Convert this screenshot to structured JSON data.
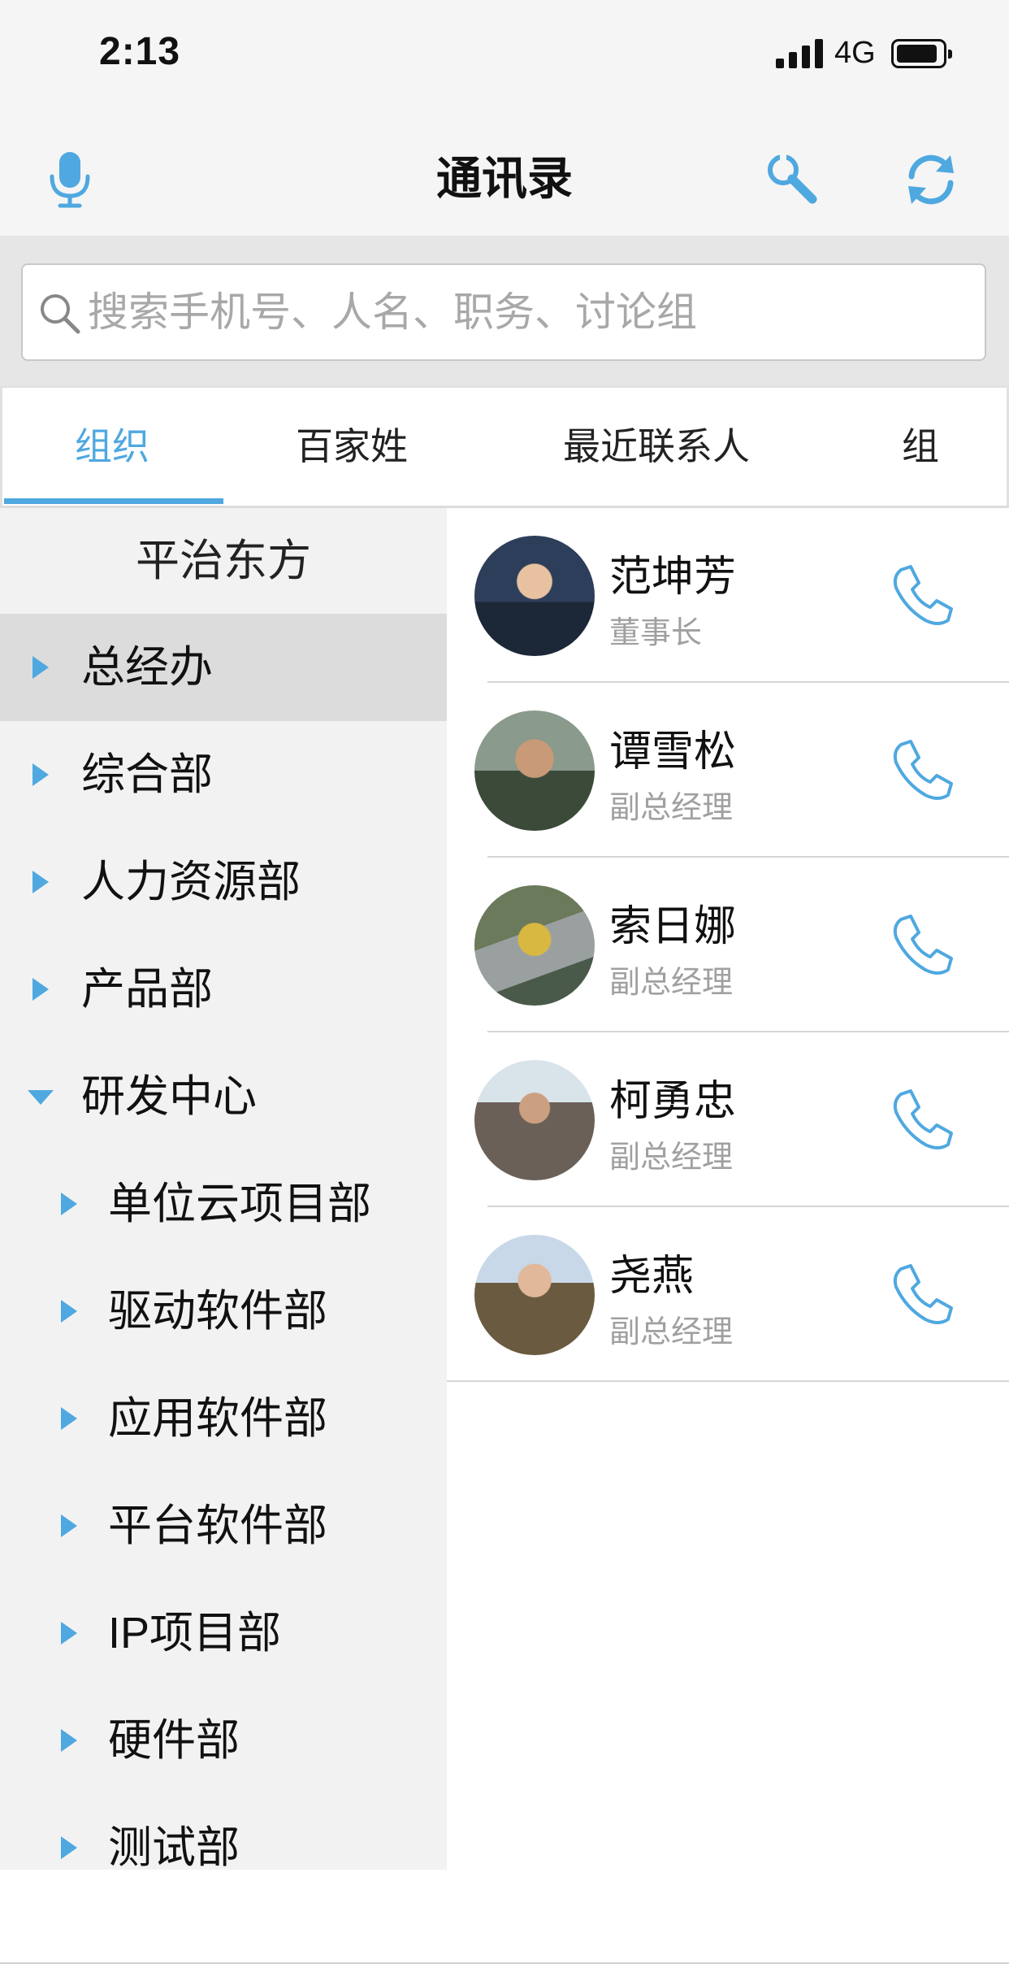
{
  "status_bar": {
    "time": "2:13",
    "network": "4G",
    "signal_bars": 4,
    "battery_level": 0.9
  },
  "nav": {
    "title": "通讯录",
    "left_icon": "mic-icon",
    "right_icons": [
      "wrench-icon",
      "refresh-icon"
    ]
  },
  "search": {
    "placeholder": "搜索手机号、人名、职务、讨论组",
    "value": ""
  },
  "tabs": [
    {
      "label": "组织",
      "active": true
    },
    {
      "label": "百家姓",
      "active": false
    },
    {
      "label": "最近联系人",
      "active": false
    },
    {
      "label": "组",
      "active": false
    }
  ],
  "sidebar": {
    "header": "平治东方",
    "items": [
      {
        "label": "总经办",
        "level": 0,
        "expanded": false,
        "selected": true
      },
      {
        "label": "综合部",
        "level": 0,
        "expanded": false,
        "selected": false
      },
      {
        "label": "人力资源部",
        "level": 0,
        "expanded": false,
        "selected": false
      },
      {
        "label": "产品部",
        "level": 0,
        "expanded": false,
        "selected": false
      },
      {
        "label": "研发中心",
        "level": 0,
        "expanded": true,
        "selected": false
      },
      {
        "label": "单位云项目部",
        "level": 1,
        "expanded": false,
        "selected": false
      },
      {
        "label": "驱动软件部",
        "level": 1,
        "expanded": false,
        "selected": false
      },
      {
        "label": "应用软件部",
        "level": 1,
        "expanded": false,
        "selected": false
      },
      {
        "label": "平台软件部",
        "level": 1,
        "expanded": false,
        "selected": false
      },
      {
        "label": "IP项目部",
        "level": 1,
        "expanded": false,
        "selected": false
      },
      {
        "label": "硬件部",
        "level": 1,
        "expanded": false,
        "selected": false
      },
      {
        "label": "测试部",
        "level": 1,
        "expanded": false,
        "selected": false
      }
    ]
  },
  "contacts": [
    {
      "name": "范坤芳",
      "title": "董事长"
    },
    {
      "name": "谭雪松",
      "title": "副总经理"
    },
    {
      "name": "索日娜",
      "title": "副总经理"
    },
    {
      "name": "柯勇忠",
      "title": "副总经理"
    },
    {
      "name": "尧燕",
      "title": "副总经理"
    }
  ],
  "colors": {
    "accent": "#4fa8e0",
    "sidebar_bg": "#f2f2f2",
    "selected_bg": "#dcdcdc",
    "subtitle": "#a0a0a0"
  }
}
